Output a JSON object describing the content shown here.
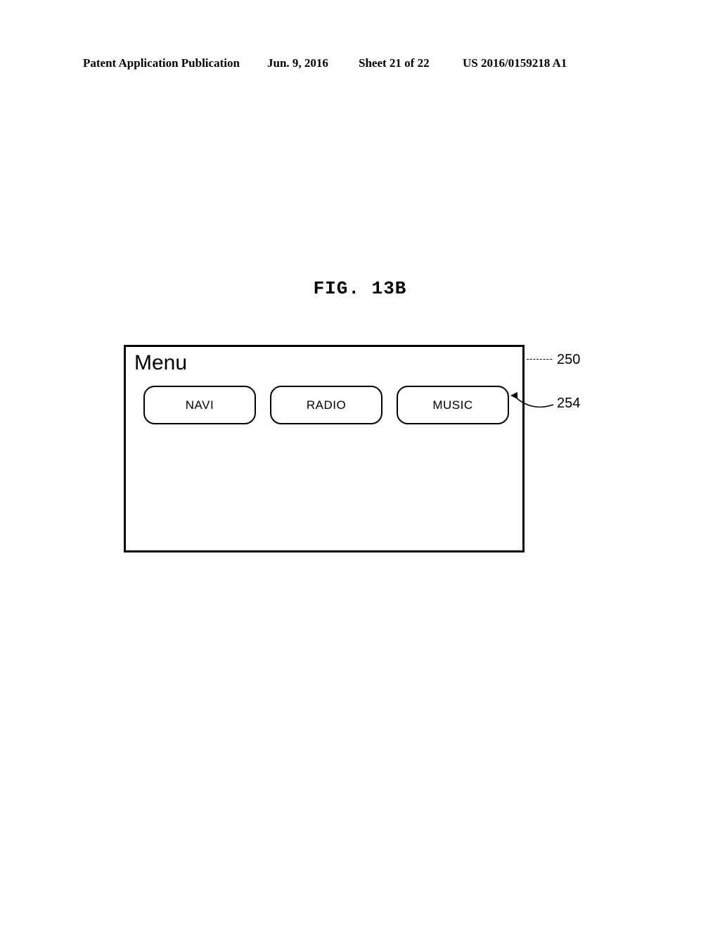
{
  "header": {
    "left": "Patent Application Publication",
    "date": "Jun. 9, 2016",
    "sheet": "Sheet 21 of 22",
    "pubno": "US 2016/0159218 A1"
  },
  "figure": {
    "label": "FIG.  13B",
    "menu_title": "Menu",
    "buttons": [
      "NAVI",
      "RADIO",
      "MUSIC"
    ],
    "ref_screen": "250",
    "ref_button": "254"
  }
}
